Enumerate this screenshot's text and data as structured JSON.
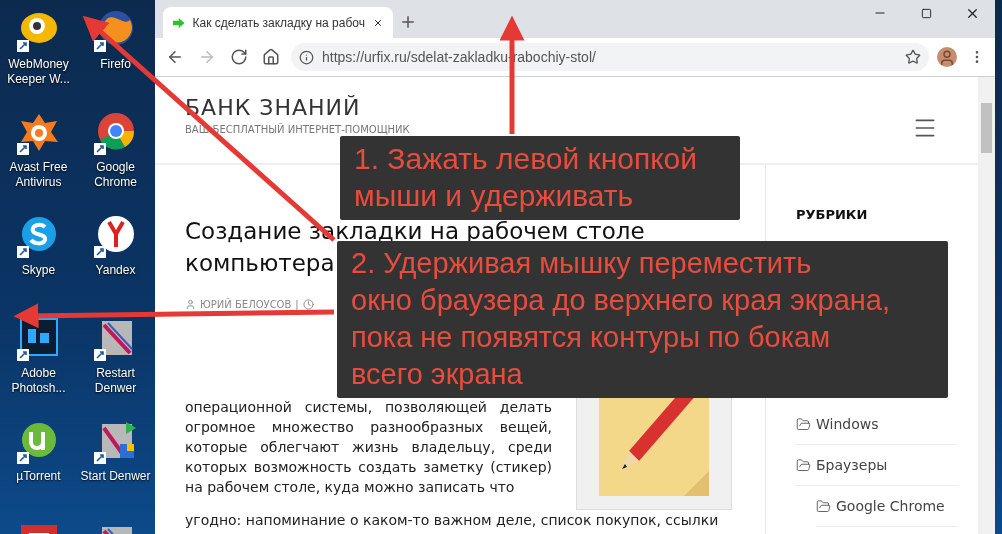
{
  "desktop": {
    "icons": [
      {
        "label": "WebMoney Keeper W...",
        "kind": "webmoney"
      },
      {
        "label": "Firefo",
        "kind": "firefox"
      },
      {
        "label": "Avast Free Antivirus",
        "kind": "avast"
      },
      {
        "label": "Google Chrome",
        "kind": "chrome"
      },
      {
        "label": "Skype",
        "kind": "skype"
      },
      {
        "label": "Yandex",
        "kind": "yandex"
      },
      {
        "label": "Adobe Photosh...",
        "kind": "photoshop"
      },
      {
        "label": "Restart Denwer",
        "kind": "denwer"
      },
      {
        "label": "µTorrent",
        "kind": "utorrent"
      },
      {
        "label": "Start Denwer",
        "kind": "denwer_start"
      },
      {
        "kind": "red_app"
      },
      {
        "kind": "denwer"
      }
    ]
  },
  "browser": {
    "tabs": [
      {
        "title": "Как сделать закладку на рабоч",
        "selected": true
      }
    ],
    "nav_buttons": [
      {
        "kind": "back",
        "disabled": false
      },
      {
        "kind": "forward",
        "disabled": true
      },
      {
        "kind": "reload",
        "disabled": false
      },
      {
        "kind": "home",
        "disabled": false
      }
    ],
    "address": "https://urfix.ru/sdelat-zakladku-rabochiy-stol/"
  },
  "site": {
    "title": "БАНК ЗНАНИЙ",
    "subtitle": "ВАШ БЕСПЛАТНЫЙ ИНТЕРНЕТ-ПОМОЩНИК"
  },
  "article": {
    "title_lines": [
      "Создание закладки на рабочем столе",
      "компьютера"
    ],
    "author": "ЮРИЙ БЕЛОУСОВ",
    "separator": "|",
    "paragraph": [
      "операционной системы, позволяющей делать огромное множество разнообразных вещей, которые облегчают жизнь владельцу, среди которых возможность создать заметку (стикер) на рабочем столе, куда можно записать что",
      "угодно: напоминание о каком-то важном деле, список покупок, ссылки"
    ]
  },
  "sidebar": {
    "heading": "РУБРИКИ",
    "categories": [
      {
        "label": "Windows"
      },
      {
        "label": "Браузеры",
        "children": [
          {
            "label": "Google Chrome"
          }
        ]
      }
    ]
  },
  "annotations": [
    {
      "lines": [
        "1. Зажать левой кнопкой",
        "мыши и удерживать"
      ]
    },
    {
      "lines": [
        "2. Удерживая мышку переместить",
        "окно браузера до верхнего края экрана,",
        "пока не появятся контуры по бокам",
        "всего экрана"
      ]
    }
  ]
}
